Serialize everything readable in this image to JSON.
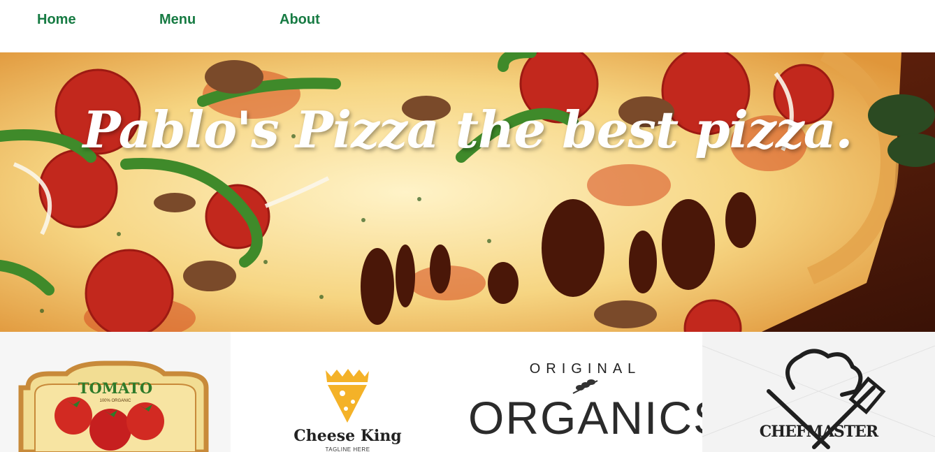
{
  "nav": {
    "items": [
      {
        "label": "Home"
      },
      {
        "label": "Menu"
      },
      {
        "label": "About"
      }
    ],
    "color": "#177b43"
  },
  "hero": {
    "title": "Pablo's Pizza the best pizza.",
    "image": "pizza-slice-photo"
  },
  "logos": [
    {
      "name": "TOMATO",
      "subtitle": "100% ORGANIC",
      "icon": "tomato-icon"
    },
    {
      "name": "Cheese King",
      "tagline": "TAGLINE HERE",
      "icon": "cheese-crown-icon"
    },
    {
      "top": "ORIGINAL",
      "name": "ORGANICS",
      "icon": "herb-sprig-icon"
    },
    {
      "name": "CHEFMASTER",
      "icon": "chef-hat-utensils-icon"
    }
  ]
}
